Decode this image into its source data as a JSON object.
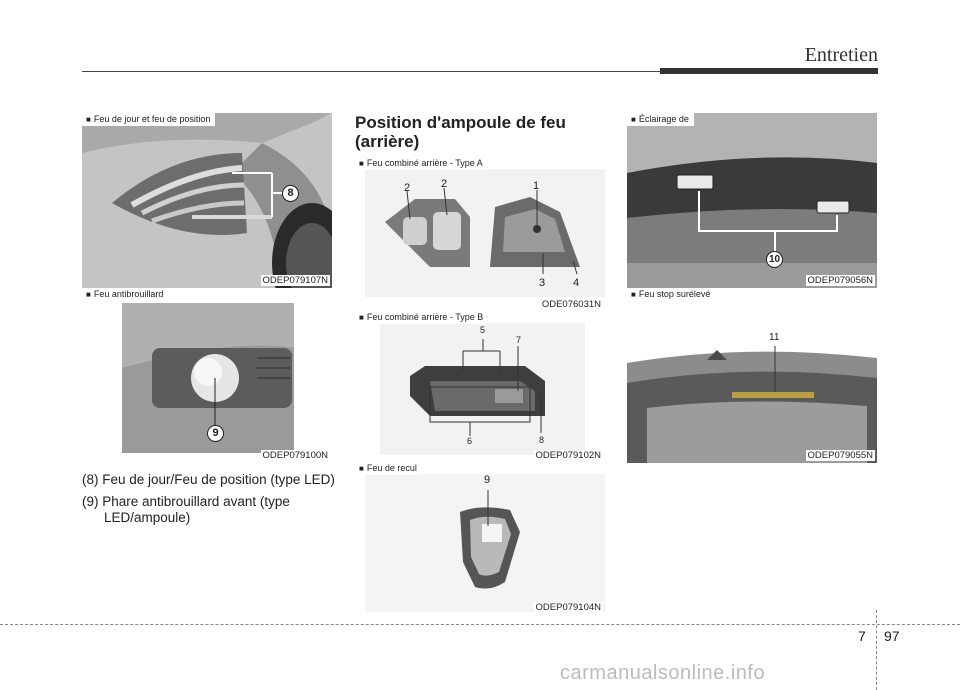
{
  "header": {
    "title": "Entretien"
  },
  "section_title": "Position d'ampoule de feu (arrière)",
  "figures": {
    "drl": {
      "caption": "Feu de jour et feu de position",
      "code": "ODEP079107N",
      "callout": "8"
    },
    "fog": {
      "caption": "Feu antibrouillard",
      "code": "ODEP079100N",
      "callout": "9"
    },
    "rear_a": {
      "caption": "Feu combiné arrière - Type A",
      "code": "ODE076031N",
      "labels": [
        "2",
        "2",
        "1",
        "3",
        "4"
      ]
    },
    "rear_b": {
      "caption": "Feu combiné arrière - Type B",
      "code": "ODEP079102N",
      "labels": [
        "5",
        "7",
        "6",
        "8"
      ]
    },
    "reverse": {
      "caption": "Feu de recul",
      "code": "ODEP079104N",
      "label": "9"
    },
    "plate": {
      "caption": "Éclairage de",
      "code": "ODEP079056N",
      "callout": "10"
    },
    "stop": {
      "caption": "Feu stop surélevé",
      "code": "ODEP079055N",
      "label": "11"
    }
  },
  "legend": [
    "(8) Feu de jour/Feu de position (type LED)",
    "(9) Phare antibrouillard avant (type LED/ampoule)"
  ],
  "footer": {
    "chapter": "7",
    "page": "97"
  },
  "watermark": "carmanualsonline.info"
}
